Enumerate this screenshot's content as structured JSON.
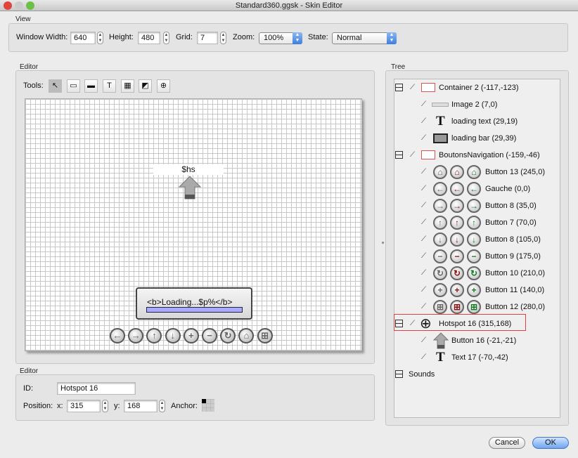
{
  "window": {
    "title": "Standard360.ggsk - Skin Editor"
  },
  "view": {
    "label": "View",
    "window_width_label": "Window Width:",
    "window_width": "640",
    "height_label": "Height:",
    "height": "480",
    "grid_label": "Grid:",
    "grid": "7",
    "zoom_label": "Zoom:",
    "zoom": "100%",
    "state_label": "State:",
    "state": "Normal"
  },
  "editor": {
    "label": "Editor",
    "tools_label": "Tools:",
    "tools": [
      {
        "icon": "pointer-icon",
        "glyph": "↖"
      },
      {
        "icon": "rectangle-icon",
        "glyph": "▭"
      },
      {
        "icon": "filled-rectangle-icon",
        "glyph": "▬"
      },
      {
        "icon": "text-icon",
        "glyph": "T"
      },
      {
        "icon": "image-icon",
        "glyph": "▦"
      },
      {
        "icon": "button-icon",
        "glyph": "◩"
      },
      {
        "icon": "hotspot-icon",
        "glyph": "⊕"
      }
    ],
    "canvas": {
      "hotspot_text": "$hs",
      "loading_text": "<b>Loading...$p%</b>",
      "loading_bar_color": "#aaaaff",
      "nav_buttons": [
        {
          "icon": "arrow-left-icon",
          "glyph": "←"
        },
        {
          "icon": "arrow-right-icon",
          "glyph": "→"
        },
        {
          "icon": "arrow-up-icon",
          "glyph": "↑"
        },
        {
          "icon": "arrow-down-icon",
          "glyph": "↓"
        },
        {
          "icon": "zoom-in-icon",
          "glyph": "+"
        },
        {
          "icon": "zoom-out-icon",
          "glyph": "−"
        },
        {
          "icon": "rotate-icon",
          "glyph": "↻"
        },
        {
          "icon": "home-icon",
          "glyph": "⌂"
        },
        {
          "icon": "fullscreen-icon",
          "glyph": "⊞"
        }
      ]
    }
  },
  "tree": {
    "label": "Tree",
    "container": "Container 2 (-117,-123)",
    "container_children": [
      "Image 2 (7,0)",
      "loading text (29,19)",
      "loading bar (29,39)"
    ],
    "nav": "BoutonsNavigation (-159,-46)",
    "buttons": [
      {
        "label": "Button 13 (245,0)",
        "glyph": "⌂"
      },
      {
        "label": "Gauche (0,0)",
        "glyph": "←"
      },
      {
        "label": "Button 8 (35,0)",
        "glyph": "→"
      },
      {
        "label": "Button 7 (70,0)",
        "glyph": "↑"
      },
      {
        "label": "Button 8 (105,0)",
        "glyph": "↓"
      },
      {
        "label": "Button 9 (175,0)",
        "glyph": "−"
      },
      {
        "label": "Button 10 (210,0)",
        "glyph": "↻"
      },
      {
        "label": "Button 11 (140,0)",
        "glyph": "+"
      },
      {
        "label": "Button 12 (280,0)",
        "glyph": "⊞"
      }
    ],
    "hotspot": "Hotspot 16 (315,168)",
    "hotspot_children": [
      "Button 16 (-21,-21)",
      "Text 17 (-70,-42)"
    ],
    "sounds": "Sounds",
    "selected_color": "#e04040"
  },
  "props": {
    "label": "Editor",
    "id_label": "ID:",
    "id": "Hotspot 16",
    "position_label": "Position:",
    "x_label": "x:",
    "x": "315",
    "y_label": "y:",
    "y": "168",
    "anchor_label": "Anchor:"
  },
  "footer": {
    "cancel": "Cancel",
    "ok": "OK"
  }
}
